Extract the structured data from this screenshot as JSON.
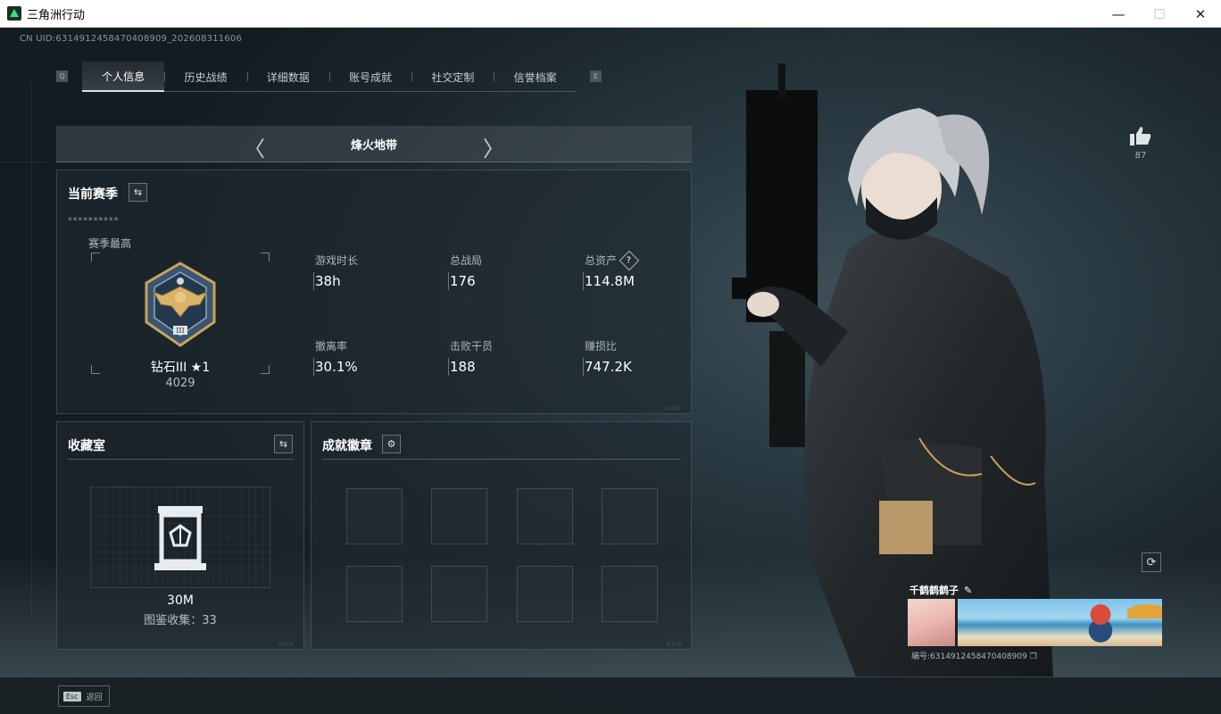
{
  "window": {
    "title": "三角洲行动",
    "minimize": "—",
    "maximize": "☐",
    "close": "✕"
  },
  "uid_text": "CN UID:6314912458470408909_202608311606",
  "tab_keys": {
    "left": "Q",
    "right": "E"
  },
  "tabs": [
    {
      "label": "个人信息",
      "active": true
    },
    {
      "label": "历史战绩",
      "active": false
    },
    {
      "label": "详细数据",
      "active": false
    },
    {
      "label": "账号成就",
      "active": false
    },
    {
      "label": "社交定制",
      "active": false
    },
    {
      "label": "信誉档案",
      "active": false
    }
  ],
  "mode": {
    "label": "烽火地带",
    "prev": "〈",
    "next": "〉"
  },
  "season": {
    "title": "当前赛季",
    "best_label": "赛季最高",
    "rank_name": "钻石III ★1",
    "rank_score": "4029",
    "stats": [
      {
        "label": "游戏时长",
        "value": "38h"
      },
      {
        "label": "总战局",
        "value": "176"
      },
      {
        "label": "总资产",
        "value": "114.8M",
        "help": "?"
      },
      {
        "label": "撤离率",
        "value": "30.1%"
      },
      {
        "label": "击败干员",
        "value": "188"
      },
      {
        "label": "赚损比",
        "value": "747.2K"
      }
    ]
  },
  "collection": {
    "title": "收藏室",
    "value": "30M",
    "count_text": "图鉴收集：33"
  },
  "achievements": {
    "title": "成就徽章",
    "slots": 8
  },
  "like": {
    "count": "87"
  },
  "profile": {
    "name": "千鹤鹤鹤子",
    "id_text": "编号:6314912458470408909"
  },
  "footer": {
    "esc_key": "Esc",
    "back_label": "返回"
  },
  "colors": {
    "accent": "#d8e0e2",
    "badge_gold": "#c9a35a",
    "badge_blue": "#5b7a99",
    "app_icon_green": "#3ee07a"
  }
}
